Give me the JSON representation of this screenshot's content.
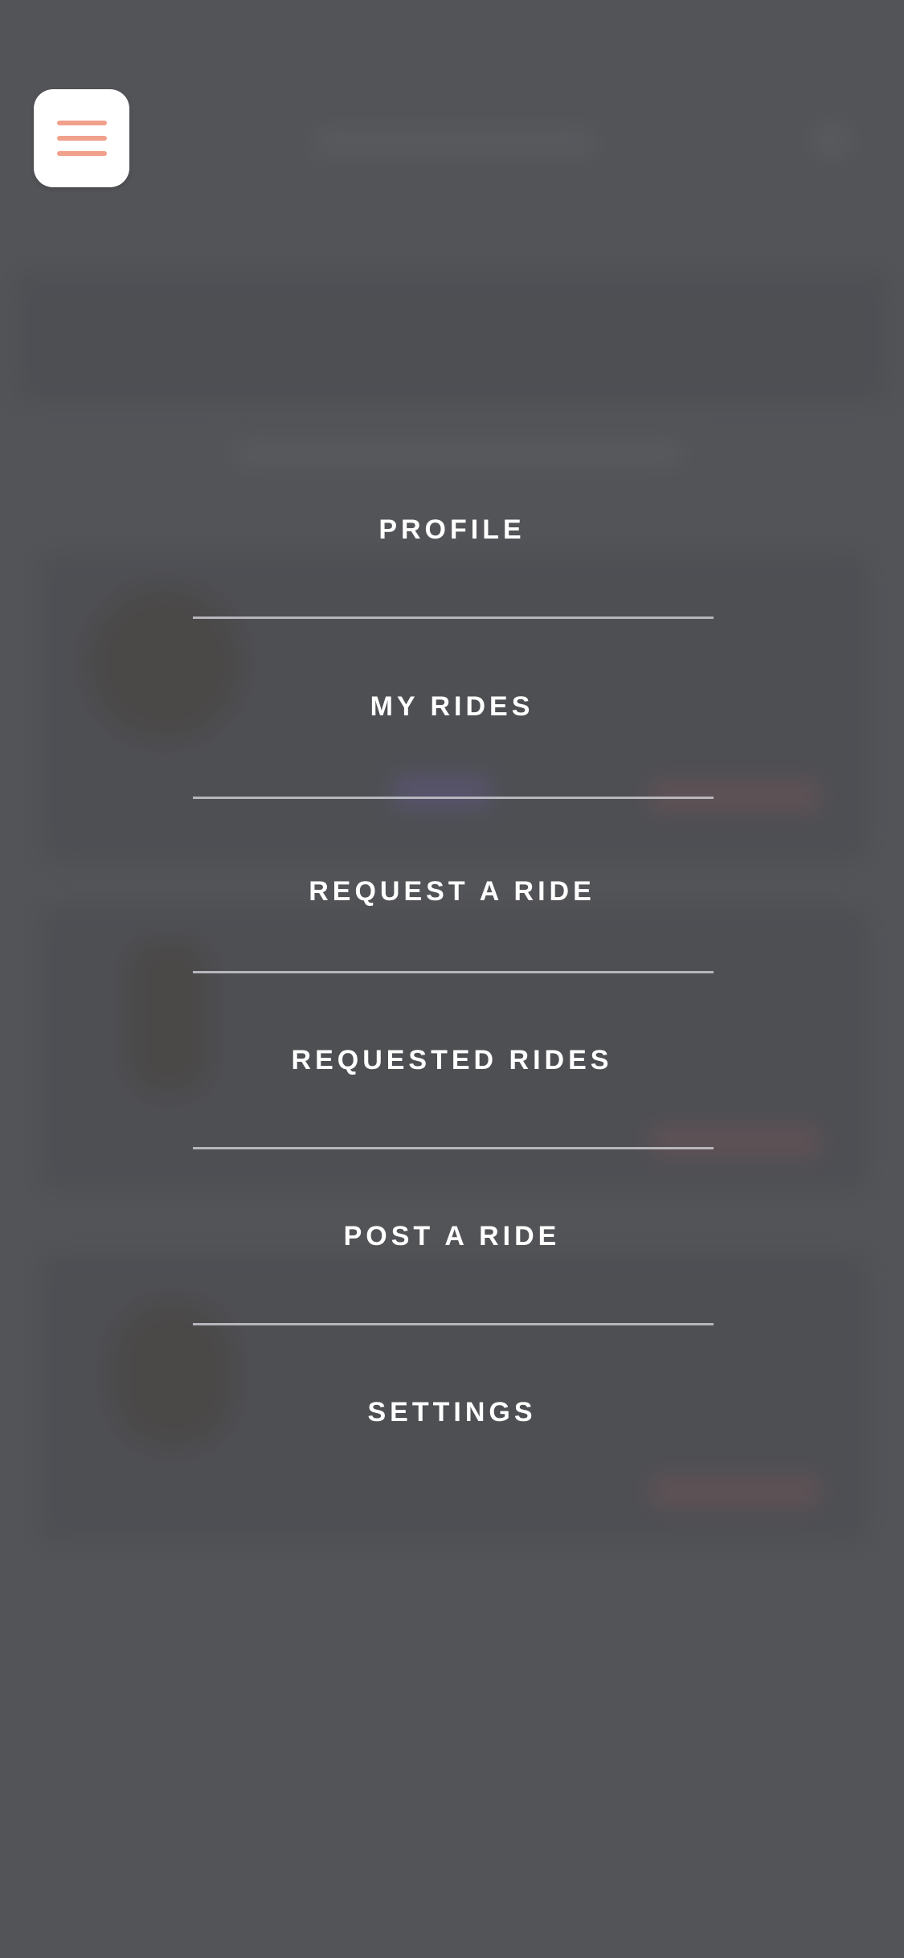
{
  "menu_button": {
    "icon": "hamburger-menu-icon",
    "accent_color": "#f1a08c"
  },
  "menu": {
    "items": [
      {
        "label": "PROFILE"
      },
      {
        "label": "MY RIDES"
      },
      {
        "label": "REQUEST A RIDE"
      },
      {
        "label": "REQUESTED RIDES"
      },
      {
        "label": "POST A RIDE"
      },
      {
        "label": "SETTINGS"
      }
    ]
  },
  "colors": {
    "overlay": "#535458",
    "menu_text": "#ffffff",
    "divider": "#c9c9cf"
  }
}
